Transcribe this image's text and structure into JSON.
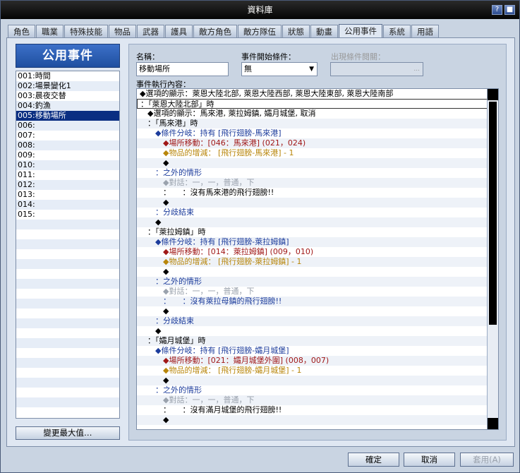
{
  "window": {
    "title": "資料庫",
    "help": "?"
  },
  "tabs": [
    "角色",
    "職業",
    "特殊技能",
    "物品",
    "武器",
    "護具",
    "敵方角色",
    "敵方隊伍",
    "狀態",
    "動畫",
    "公用事件",
    "系統",
    "用語"
  ],
  "left": {
    "header": "公用事件",
    "items": [
      "001:時間",
      "002:場景變化1",
      "003:晨夜交替",
      "004:釣漁",
      "005:移動場所",
      "006:",
      "007:",
      "008:",
      "009:",
      "010:",
      "011:",
      "012:",
      "013:",
      "014:",
      "015:"
    ],
    "max_button": "變更最大值…"
  },
  "form": {
    "name_label": "名稱：",
    "name_value": "移動場所",
    "trigger_label": "事件開始條件：",
    "trigger_value": "無",
    "switch_label": "出現條件閱關：",
    "switch_btn": "...",
    "content_label": "事件執行內容："
  },
  "code": [
    {
      "t": "◆選項的顯示：萊恩大陸北部, 萊恩大陸西部, 萊恩大陸東部, 萊恩大陸南部",
      "c": "",
      "i": 0
    },
    {
      "t": "：「萊恩大陸北部」時",
      "c": "",
      "i": 0
    },
    {
      "t": "◆選項的顯示：馬來港, 萊拉姆鎮, 孀月城堡, 取消",
      "c": "",
      "i": 1
    },
    {
      "t": "：「馬來港」時",
      "c": "",
      "i": 1
    },
    {
      "t": "◆條件分岐：持有 [飛行翅膀-馬來港]",
      "c": "blue",
      "i": 2
    },
    {
      "t": "◆場所移動：[046：馬來港] (021，024)",
      "c": "red",
      "i": 3
    },
    {
      "t": "◆物品的增減： [飛行翅膀-馬來港] - 1",
      "c": "gold",
      "i": 3
    },
    {
      "t": "◆",
      "c": "",
      "i": 3
    },
    {
      "t": "：之外的情形",
      "c": "blue",
      "i": 2
    },
    {
      "t": "◆對話：一，一，普通，下",
      "c": "gray",
      "i": 3
    },
    {
      "t": "：　　：沒有馬來港的飛行翅膀!!",
      "c": "",
      "i": 3
    },
    {
      "t": "◆",
      "c": "",
      "i": 3
    },
    {
      "t": "：分歧結束",
      "c": "blue",
      "i": 2
    },
    {
      "t": "◆",
      "c": "",
      "i": 2
    },
    {
      "t": "：「萊拉姆鎮」時",
      "c": "",
      "i": 1
    },
    {
      "t": "◆條件分岐：持有 [飛行翅膀-萊拉姆鎮]",
      "c": "blue",
      "i": 2
    },
    {
      "t": "◆場所移動：[014：萊拉姆鎮] (009，010)",
      "c": "red",
      "i": 3
    },
    {
      "t": "◆物品的增減： [飛行翅膀-萊拉姆鎮] - 1",
      "c": "gold",
      "i": 3
    },
    {
      "t": "◆",
      "c": "",
      "i": 3
    },
    {
      "t": "：之外的情形",
      "c": "blue",
      "i": 2
    },
    {
      "t": "◆對話：一，一，普通，下",
      "c": "gray",
      "i": 3
    },
    {
      "t": "：　　：沒有萊拉母鎮的飛行翅膀!!",
      "c": "blue",
      "i": 3
    },
    {
      "t": "◆",
      "c": "",
      "i": 3
    },
    {
      "t": "：分歧結束",
      "c": "blue",
      "i": 2
    },
    {
      "t": "◆",
      "c": "",
      "i": 2
    },
    {
      "t": "：「孀月城堡」時",
      "c": "",
      "i": 1
    },
    {
      "t": "◆條件分岐：持有 [飛行翅膀-孀月城堡]",
      "c": "blue",
      "i": 2
    },
    {
      "t": "◆場所移動：[021：孀月城堡外圍] (008，007)",
      "c": "red",
      "i": 3
    },
    {
      "t": "◆物品的增減： [飛行翅膀-孀月城堡] - 1",
      "c": "gold",
      "i": 3
    },
    {
      "t": "◆",
      "c": "",
      "i": 3
    },
    {
      "t": "：之外的情形",
      "c": "blue",
      "i": 2
    },
    {
      "t": "◆對話：一，一，普通，下",
      "c": "gray",
      "i": 3
    },
    {
      "t": "：　　：沒有滿月城堡的飛行翅膀!!",
      "c": "",
      "i": 3
    },
    {
      "t": "◆",
      "c": "",
      "i": 3
    }
  ],
  "buttons": {
    "ok": "確定",
    "cancel": "取消",
    "apply": "套用(A)"
  }
}
